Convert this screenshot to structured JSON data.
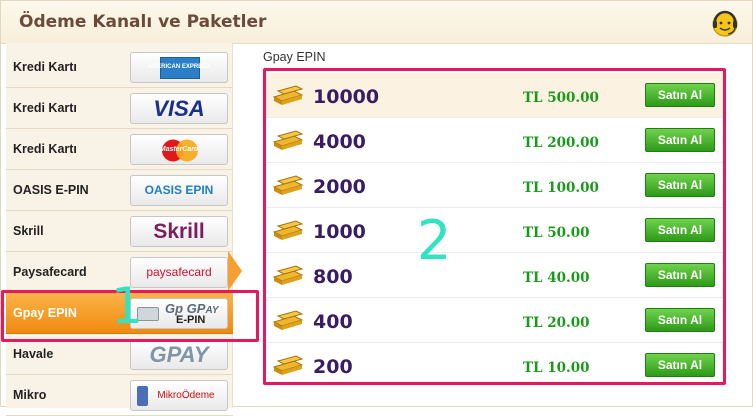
{
  "header": {
    "title": "Ödeme Kanalı ve Paketler"
  },
  "sidebar": {
    "methods": [
      {
        "label": "Kredi Kartı",
        "logo_text": "AMERICAN EXPRESS"
      },
      {
        "label": "Kredi Kartı",
        "logo_text": "VISA"
      },
      {
        "label": "Kredi Kartı",
        "logo_text": "MasterCard"
      },
      {
        "label": "OASIS E-PIN",
        "logo_text": "OASIS EPIN"
      },
      {
        "label": "Skrill",
        "logo_text": "Skrill"
      },
      {
        "label": "Paysafecard",
        "logo_text": "paysafecard"
      },
      {
        "label": "Gpay EPIN",
        "logo_text": "E-PIN"
      },
      {
        "label": "Havale",
        "logo_text": "GPAY"
      },
      {
        "label": "Mikro",
        "logo_text": "MikroÖdeme"
      }
    ]
  },
  "content": {
    "label": "Gpay EPIN",
    "buy_label": "Satın Al",
    "packages": [
      {
        "amount": "10000",
        "price": "TL 500.00"
      },
      {
        "amount": "4000",
        "price": "TL 200.00"
      },
      {
        "amount": "2000",
        "price": "TL 100.00"
      },
      {
        "amount": "1000",
        "price": "TL 50.00"
      },
      {
        "amount": "800",
        "price": "TL 40.00"
      },
      {
        "amount": "400",
        "price": "TL 20.00"
      },
      {
        "amount": "200",
        "price": "TL 10.00"
      }
    ]
  },
  "annotations": {
    "one": "1",
    "two": "2"
  },
  "colors": {
    "accent_orange": "#f08a10",
    "annotation_pink": "#e8185e",
    "annotation_teal": "#31e3c0",
    "price_green": "#1a9a1a"
  }
}
